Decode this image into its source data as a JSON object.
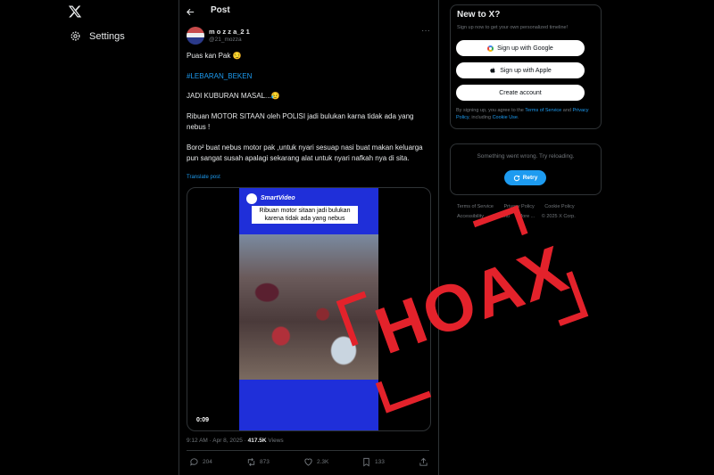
{
  "nav": {
    "logo": "X",
    "settings_label": "Settings"
  },
  "header": {
    "title": "Post"
  },
  "post": {
    "display_name": "m o z z a_2 1",
    "handle": "@21_mozza",
    "line1": "Puas kan Pak 😏",
    "hashtag": "#LEBARAN_BEKEN",
    "line3": "JADI KUBURAN MASAL...😥",
    "line4": "Ribuan MOTOR SITAAN oleh POLISI jadi bulukan karna tidak ada yang nebus !",
    "line5": "Boro² buat nebus motor pak ,untuk nyari sesuap nasi buat makan keluarga pun sangat susah apalagi sekarang alat untuk nyari nafkah nya di sita.",
    "translate": "Translate post",
    "video": {
      "overlay_caption": "Ribuan motor sitaan jadi bulukan karena tidak ada yang nebus",
      "watermark": "SmartVideo",
      "duration": "0:09"
    },
    "time": "9:12 AM · Apr 8, 2025 · ",
    "views_count": "417.5K",
    "views_label": " Views",
    "actions": {
      "replies": "204",
      "reposts": "873",
      "likes": "2.3K",
      "bookmarks": "133"
    }
  },
  "signup": {
    "title": "New to X?",
    "subtitle": "Sign up now to get your own personalized timeline!",
    "google_btn": "Sign up with Google",
    "apple_btn": "Sign up with Apple",
    "create_btn": "Create account",
    "legal_1": "By signing up, you agree to the ",
    "legal_tos": "Terms of Service",
    "legal_2": " and ",
    "legal_privacy": "Privacy Policy",
    "legal_3": ", including ",
    "legal_cookie": "Cookie Use",
    "legal_4": "."
  },
  "error_box": {
    "message": "Something went wrong. Try reloading.",
    "retry": "Retry"
  },
  "footer": {
    "links": [
      "Terms of Service",
      "Privacy Policy",
      "Cookie Policy",
      "Accessibility",
      "Ads info",
      "More ..."
    ],
    "copyright": "© 2025 X Corp."
  },
  "stamp": {
    "text": "HOAX",
    "color": "#e3222b"
  },
  "colors": {
    "accent": "#1d9bf0",
    "background": "#000000",
    "border": "#2f3336",
    "muted": "#71767b"
  }
}
